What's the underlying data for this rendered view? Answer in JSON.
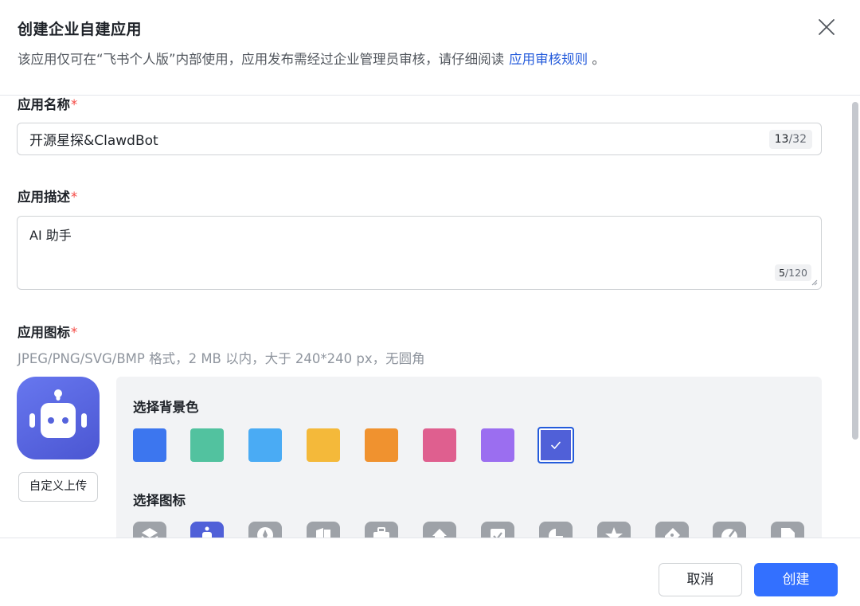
{
  "dialog": {
    "title": "创建企业自建应用",
    "notice": "该应用仅可在“飞书个人版”内部使用，应用发布需经过企业管理员审核，请仔细阅读",
    "notice_link": "应用审核规则",
    "notice_end": "。"
  },
  "form": {
    "name": {
      "label": "应用名称",
      "required_mark": "*",
      "value": "开源星探&ClawdBot",
      "count": "13",
      "max": "/32"
    },
    "description": {
      "label": "应用描述",
      "required_mark": "*",
      "value": "AI 助手",
      "count": "5",
      "max": "/120"
    },
    "icon": {
      "label": "应用图标",
      "required_mark": "*",
      "hint": "JPEG/PNG/SVG/BMP 格式，2 MB 以内，大于 240*240 px，无圆角",
      "upload_label": "自定义上传",
      "bg_title": "选择背景色",
      "icon_title": "选择图标",
      "bg_colors": [
        "#3c76ef",
        "#52c29f",
        "#4aabf4",
        "#f4b93a",
        "#f0922f",
        "#df5f8f",
        "#9b6ef0",
        "#5060d8"
      ],
      "selected_bg_index": 7,
      "selected_icon_index": 1
    }
  },
  "footer": {
    "cancel_label": "取消",
    "create_label": "创建"
  }
}
